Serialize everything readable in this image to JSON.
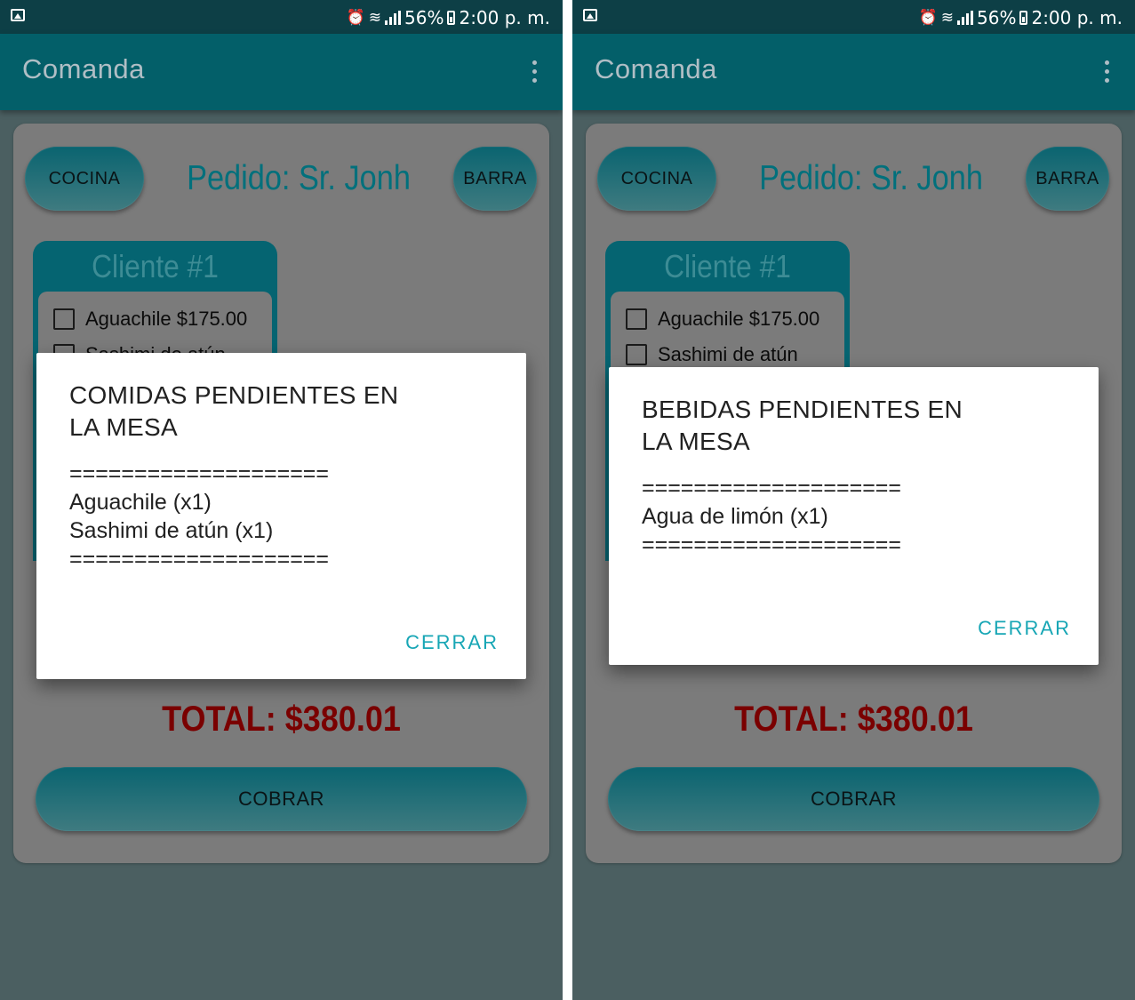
{
  "screens": [
    {
      "status": {
        "battery": "56%",
        "time": "2:00 p. m."
      },
      "toolbar": {
        "title": "Comanda"
      },
      "buttons": {
        "cocina": "COCINA",
        "barra": "BARRA",
        "cobrar": "COBRAR"
      },
      "order_title": "Pedido: Sr. Jonh",
      "client": {
        "title": "Cliente #1",
        "items": [
          {
            "label": "Aguachile $175.00",
            "checked": false
          },
          {
            "label": "Sashimi de atún",
            "checked": false
          }
        ]
      },
      "total": "TOTAL: $380.01",
      "dialog": {
        "title_line1": "COMIDAS PENDIENTES EN",
        "title_line2": "LA MESA",
        "lines": [
          "====================",
          "Aguachile (x1)",
          "Sashimi de atún (x1)",
          "===================="
        ],
        "button": "CERRAR"
      }
    },
    {
      "status": {
        "battery": "56%",
        "time": "2:00 p. m."
      },
      "toolbar": {
        "title": "Comanda"
      },
      "buttons": {
        "cocina": "COCINA",
        "barra": "BARRA",
        "cobrar": "COBRAR"
      },
      "order_title": "Pedido: Sr. Jonh",
      "client": {
        "title": "Cliente #1",
        "items": [
          {
            "label": "Aguachile $175.00",
            "checked": false
          },
          {
            "label": "Sashimi de atún",
            "checked": false
          }
        ]
      },
      "total": "TOTAL: $380.01",
      "dialog": {
        "title_line1": "BEBIDAS PENDIENTES EN",
        "title_line2": "LA MESA",
        "lines": [
          "====================",
          "Agua de limón (x1)",
          "===================="
        ],
        "button": "CERRAR"
      }
    }
  ],
  "colors": {
    "status_bar": "#0d3f46",
    "toolbar": "#035f69",
    "accent": "#17a6b5",
    "total_text": "#7a0000",
    "order_title": "#00707c"
  },
  "icons": [
    "gallery-icon",
    "alarm-icon",
    "wifi-icon",
    "signal-icon",
    "battery-icon",
    "overflow-menu-icon",
    "checkbox-icon"
  ]
}
